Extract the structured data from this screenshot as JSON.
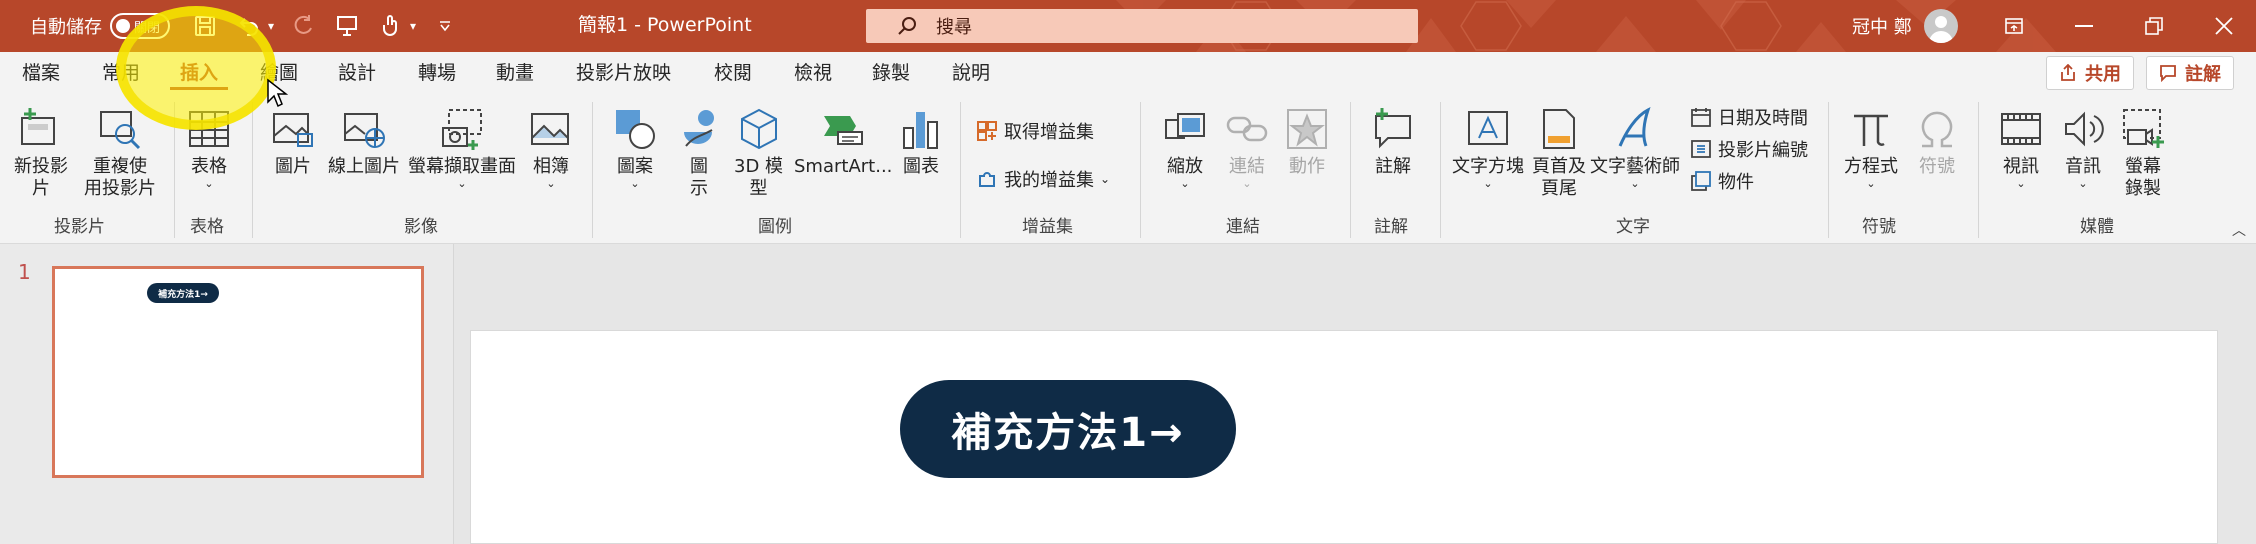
{
  "titlebar": {
    "autosave_label": "自動儲存",
    "autosave_state": "關閉",
    "doc_title": "簡報1  -  PowerPoint",
    "search_placeholder": "搜尋",
    "user_name": "冠中 鄭",
    "accent_color": "#b7472a"
  },
  "tabs": [
    "檔案",
    "常用",
    "插入",
    "繪圖",
    "設計",
    "轉場",
    "動畫",
    "投影片放映",
    "校閱",
    "檢視",
    "錄製",
    "說明"
  ],
  "active_tab": "插入",
  "actions": {
    "share": "共用",
    "comment": "註解"
  },
  "ribbon": {
    "slides": {
      "new_slide": "新投影",
      "new_slide_2": "片",
      "reuse": "重複使",
      "reuse_2": "用投影片",
      "group": "投影片"
    },
    "tables": {
      "table": "表格",
      "group": "表格"
    },
    "images": {
      "pictures": "圖片",
      "online_pictures": "線上圖片",
      "screenshot": "螢幕擷取畫面",
      "album": "相簿",
      "group": "影像"
    },
    "illustrations": {
      "shapes": "圖案",
      "icons": "圖",
      "icons_2": "示",
      "models": "3D 模",
      "models_2": "型",
      "smartart": "SmartArt...",
      "chart": "圖表",
      "group": "圖例"
    },
    "addins": {
      "get": "取得增益集",
      "mine": "我的增益集",
      "group": "增益集"
    },
    "links": {
      "zoom": "縮放",
      "link": "連結",
      "action": "動作",
      "group": "連結"
    },
    "comments": {
      "comment": "註解",
      "group": "註解"
    },
    "text": {
      "textbox": "文字方塊",
      "header": "頁首及",
      "header_2": "頁尾",
      "wordart": "文字藝術師",
      "datetime": "日期及時間",
      "slide_number": "投影片編號",
      "object": "物件",
      "group": "文字"
    },
    "symbols": {
      "equation": "方程式",
      "symbol": "符號",
      "group": "符號"
    },
    "media": {
      "video": "視訊",
      "audio": "音訊",
      "screen_rec": "螢幕",
      "screen_rec_2": "錄製",
      "group": "媒體"
    }
  },
  "slides_pane": {
    "slide_number": "1",
    "thumb_text": "補充方法1→"
  },
  "slide": {
    "pill_text": "補充方法1→",
    "pill_color": "#0f2b46"
  }
}
